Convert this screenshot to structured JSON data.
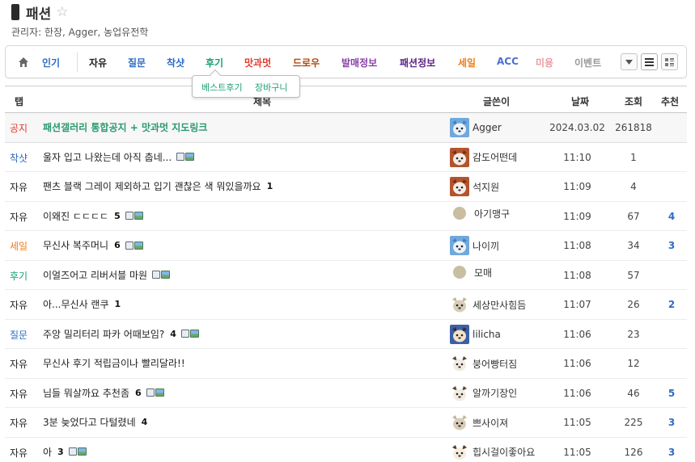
{
  "board": {
    "title": "패션",
    "managers": "관리자: 한장, Agger, 농업유전학"
  },
  "tabs": [
    {
      "label": "인기",
      "color": "#2c6cc6"
    },
    {
      "label": "자유",
      "color": "#222222"
    },
    {
      "label": "질문",
      "color": "#2c6cc6"
    },
    {
      "label": "착샷",
      "color": "#2c6cc6"
    },
    {
      "label": "후기",
      "color": "#1aa06d"
    },
    {
      "label": "맛과멋",
      "color": "#e03b2c"
    },
    {
      "label": "드로우",
      "color": "#b5470c"
    },
    {
      "label": "발매정보",
      "color": "#8a3fa8"
    },
    {
      "label": "패션정보",
      "color": "#5b2387"
    },
    {
      "label": "세일",
      "color": "#ee7d1a"
    },
    {
      "label": "ACC",
      "color": "#4a6fd0"
    },
    {
      "label": "미용",
      "color": "#e89aa0"
    },
    {
      "label": "이벤트",
      "color": "#999999"
    }
  ],
  "subpopup": [
    {
      "label": "베스트후기",
      "color": "#1aa06d"
    },
    {
      "label": "장바구니",
      "color": "#1aa06d"
    }
  ],
  "columns": {
    "tab": "탭",
    "subject": "제목",
    "writer": "글쓴이",
    "date": "날짜",
    "views": "조회",
    "rec": "추천"
  },
  "rows": [
    {
      "tab": "공지",
      "tab_color": "#e03b2c",
      "subject": "패션갤러리 통합공지 + 맛과멋 지도링크",
      "comments": "",
      "file": false,
      "image": false,
      "writer": "Agger",
      "avatar": "blue-creature",
      "date": "2024.03.02",
      "views": "261818",
      "rec": "",
      "notice": true
    },
    {
      "tab": "착샷",
      "tab_color": "#2c6cc6",
      "subject": "울자 입고 나왔는데 아직 춥네...",
      "comments": "",
      "file": true,
      "image": true,
      "writer": "감도어떤데",
      "avatar": "red-dog",
      "date": "11:10",
      "views": "1",
      "rec": ""
    },
    {
      "tab": "자유",
      "tab_color": "#222222",
      "subject": "팬츠 블랙 그레이 제외하고 입기 괜찮은 색 뭐있을까요",
      "comments": "1",
      "file": false,
      "image": false,
      "writer": "석지원",
      "avatar": "red-dog",
      "date": "11:09",
      "views": "4",
      "rec": ""
    },
    {
      "tab": "자유",
      "tab_color": "#222222",
      "subject": "이왜진 ㄷㄷㄷㄷ",
      "comments": "5",
      "file": true,
      "image": true,
      "writer": "아기맹구",
      "avatar": "dot",
      "date": "11:09",
      "views": "67",
      "rec": "4"
    },
    {
      "tab": "세일",
      "tab_color": "#ee7d1a",
      "subject": "무신사 복주머니",
      "comments": "6",
      "file": true,
      "image": true,
      "writer": "나이끼",
      "avatar": "blue-creature",
      "date": "11:08",
      "views": "34",
      "rec": "3"
    },
    {
      "tab": "후기",
      "tab_color": "#1aa06d",
      "subject": "이얼즈어고 리버서블 마원",
      "comments": "",
      "file": true,
      "image": true,
      "writer": "모매",
      "avatar": "dot",
      "date": "11:08",
      "views": "57",
      "rec": ""
    },
    {
      "tab": "자유",
      "tab_color": "#222222",
      "subject": "아...무신사 랜쿠",
      "comments": "1",
      "file": false,
      "image": false,
      "writer": "세상만사힘듬",
      "avatar": "tan-blob",
      "date": "11:07",
      "views": "26",
      "rec": "2"
    },
    {
      "tab": "질문",
      "tab_color": "#2c6cc6",
      "subject": "주앙 밀리터리 파카 어때보임?",
      "comments": "4",
      "file": true,
      "image": true,
      "writer": "lilicha",
      "avatar": "dark-dog",
      "date": "11:06",
      "views": "23",
      "rec": ""
    },
    {
      "tab": "자유",
      "tab_color": "#222222",
      "subject": "무신사 후기 적립금이나 빨리달라!!",
      "comments": "",
      "file": false,
      "image": false,
      "writer": "붕어빵터짐",
      "avatar": "white-dog",
      "date": "11:06",
      "views": "12",
      "rec": ""
    },
    {
      "tab": "자유",
      "tab_color": "#222222",
      "subject": "님들 뭐살까요 추천좀",
      "comments": "6",
      "file": true,
      "image": true,
      "writer": "알까기장인",
      "avatar": "white-dog",
      "date": "11:06",
      "views": "46",
      "rec": "5"
    },
    {
      "tab": "자유",
      "tab_color": "#222222",
      "subject": "3분 늦었다고 다털렸네",
      "comments": "4",
      "file": false,
      "image": false,
      "writer": "쁘사이져",
      "avatar": "tan-blob",
      "date": "11:05",
      "views": "225",
      "rec": "3"
    },
    {
      "tab": "자유",
      "tab_color": "#222222",
      "subject": "아",
      "comments": "3",
      "file": true,
      "image": true,
      "writer": "힙시걸이좋아요",
      "avatar": "fox-dog",
      "date": "11:05",
      "views": "126",
      "rec": "3"
    }
  ]
}
